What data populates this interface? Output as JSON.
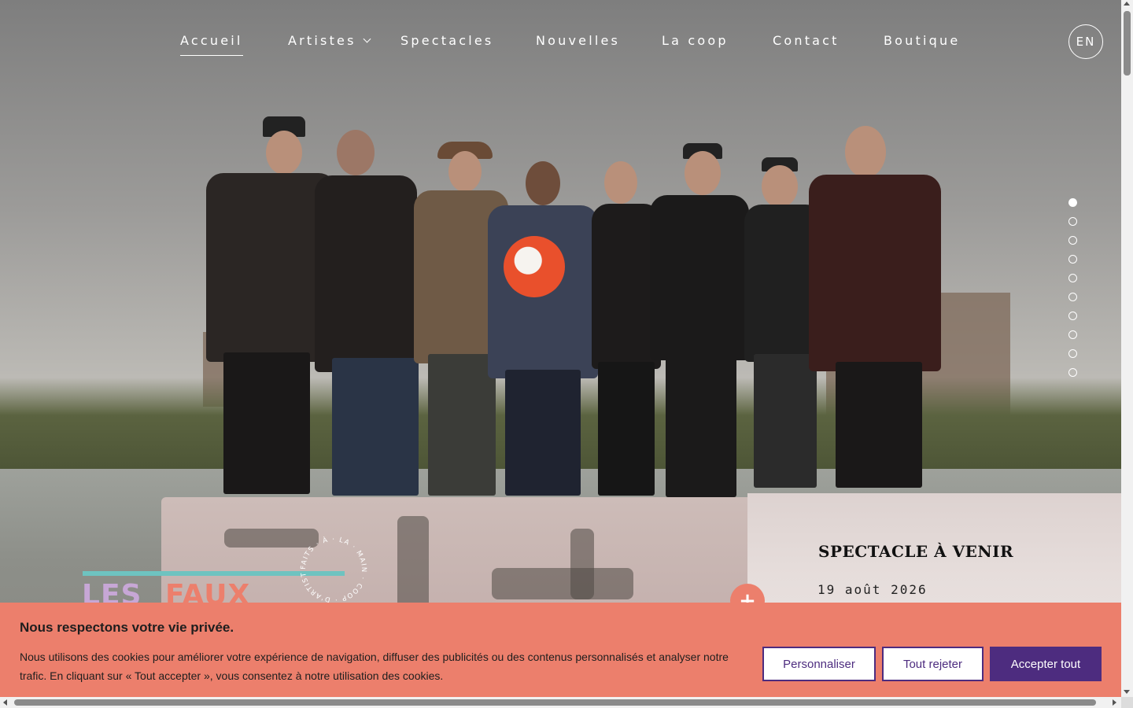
{
  "nav": {
    "items": [
      {
        "label": "Accueil",
        "active": true
      },
      {
        "label": "Artistes",
        "has_dropdown": true
      },
      {
        "label": "Spectacles"
      },
      {
        "label": "Nouvelles"
      },
      {
        "label": "La coop"
      },
      {
        "label": "Contact"
      },
      {
        "label": "Boutique"
      }
    ],
    "lang_label": "EN"
  },
  "slider": {
    "total": 10,
    "active": 1
  },
  "logo": {
    "word1": "LES",
    "word2": "FAUX",
    "stamp_text": "FAITS · À · LA · MAIN · COOP · D'ARTISTES ·"
  },
  "upcoming": {
    "title": "SPECTACLE À VENIR",
    "date": "19 août 2026",
    "more_icon": "plus-icon"
  },
  "cookie": {
    "title": "Nous respectons votre vie privée.",
    "text": "Nous utilisons des cookies pour améliorer votre expérience de navigation, diffuser des publicités ou des contenus personnalisés et analyser notre trafic. En cliquant sur « Tout accepter », vous consentez à notre utilisation des cookies.",
    "btn_customize": "Personnaliser",
    "btn_reject": "Tout rejeter",
    "btn_accept": "Accepter tout"
  },
  "colors": {
    "accent_coral": "#ec7f6c",
    "accent_purple": "#4d2c7f",
    "logo_teal": "#6ec3c0",
    "logo_lilac": "#c7a7d6"
  }
}
